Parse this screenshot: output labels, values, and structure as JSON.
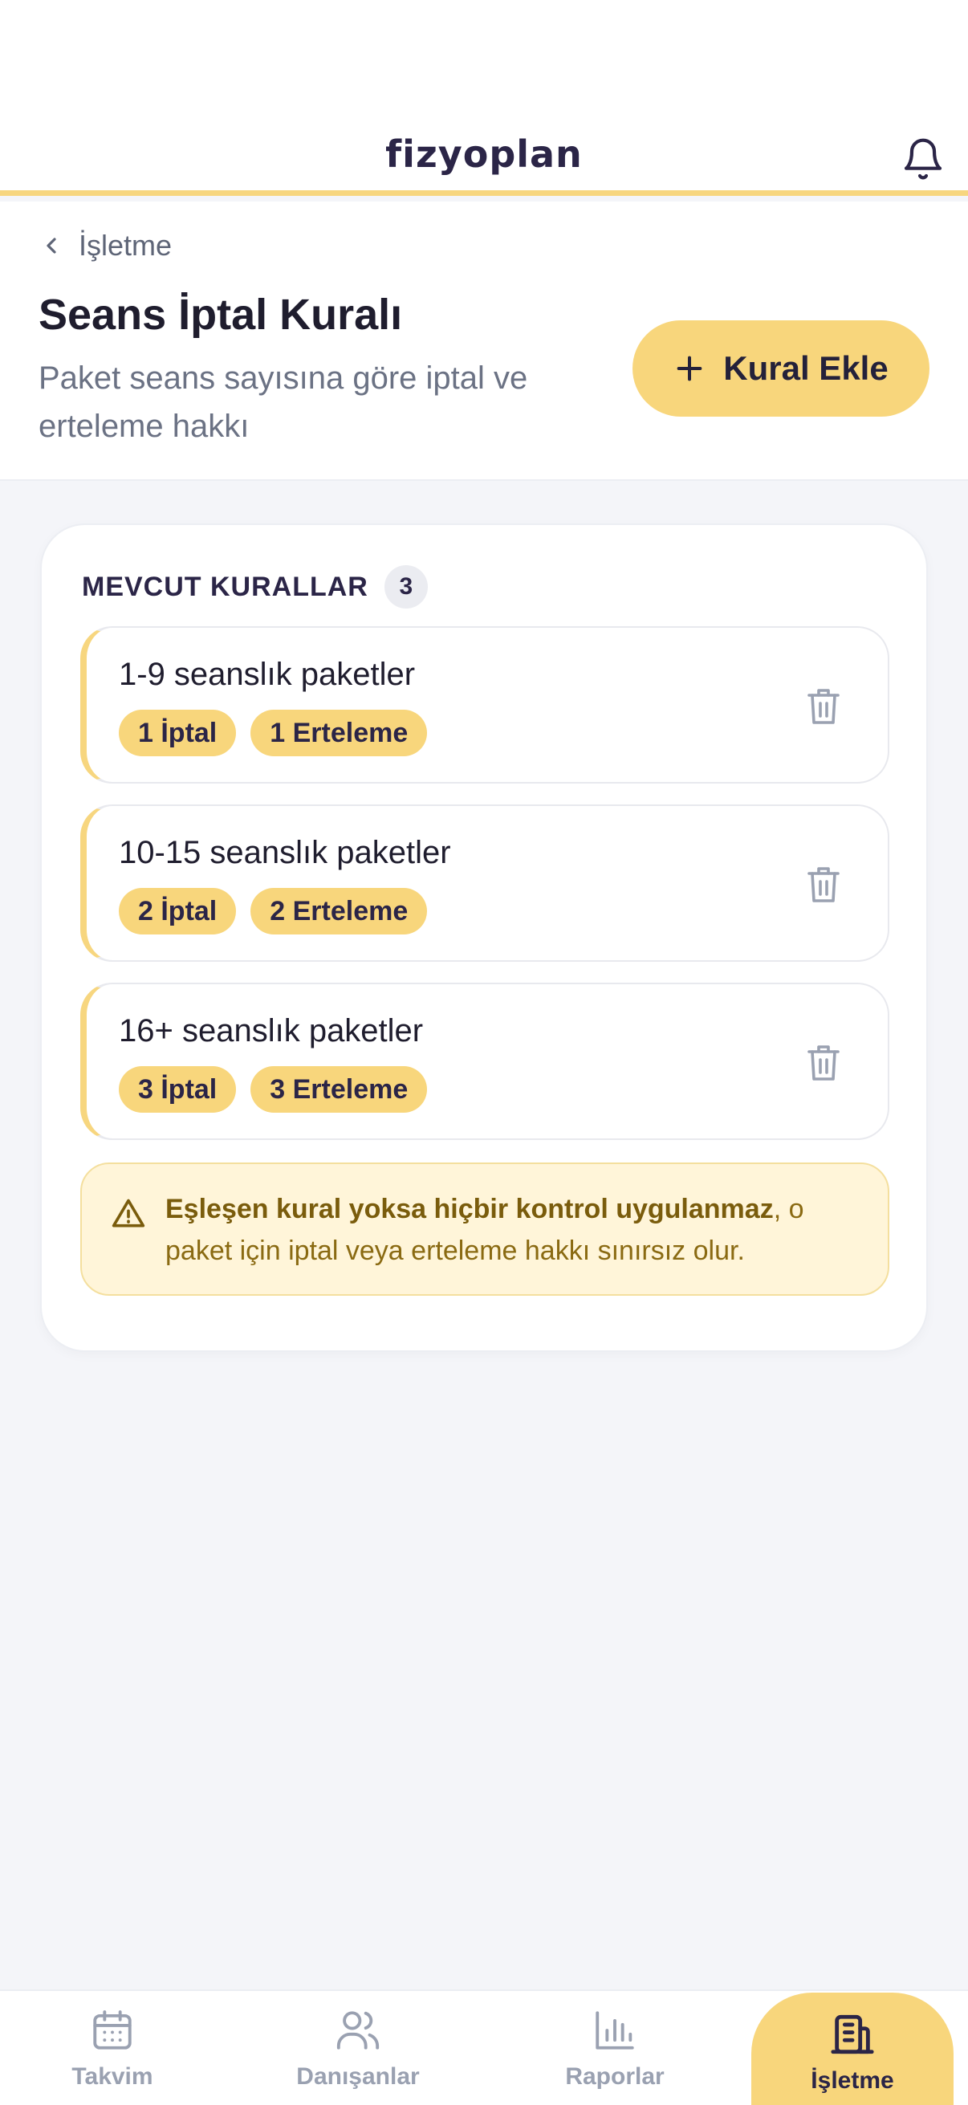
{
  "app": {
    "brand": "fizyoplan"
  },
  "header": {
    "back_label": "İşletme",
    "title": "Seans İptal Kuralı",
    "subtitle": "Paket seans sayısına göre iptal ve erteleme hakkı",
    "add_button_label": "Kural Ekle"
  },
  "rules_section": {
    "title": "MEVCUT KURALLAR",
    "count": "3",
    "rules": [
      {
        "name": "1-9 seanslık paketler",
        "cancel": "1 İptal",
        "postpone": "1 Erteleme"
      },
      {
        "name": "10-15 seanslık paketler",
        "cancel": "2 İptal",
        "postpone": "2 Erteleme"
      },
      {
        "name": "16+ seanslık paketler",
        "cancel": "3 İptal",
        "postpone": "3 Erteleme"
      }
    ],
    "notice_bold": "Eşleşen kural yoksa hiçbir kontrol uygulanmaz",
    "notice_rest": ", o paket için iptal veya erteleme hakkı sınırsız olur."
  },
  "bottom_nav": {
    "items": [
      {
        "label": "Takvim",
        "icon": "calendar-icon"
      },
      {
        "label": "Danışanlar",
        "icon": "users-icon"
      },
      {
        "label": "Raporlar",
        "icon": "bar-chart-icon"
      },
      {
        "label": "İşletme",
        "icon": "building-icon",
        "active": true
      }
    ]
  },
  "colors": {
    "accent": "#f8d67c",
    "text_dark": "#22223b",
    "muted": "#9aa1b1",
    "notice_bg": "#fff5d9"
  }
}
